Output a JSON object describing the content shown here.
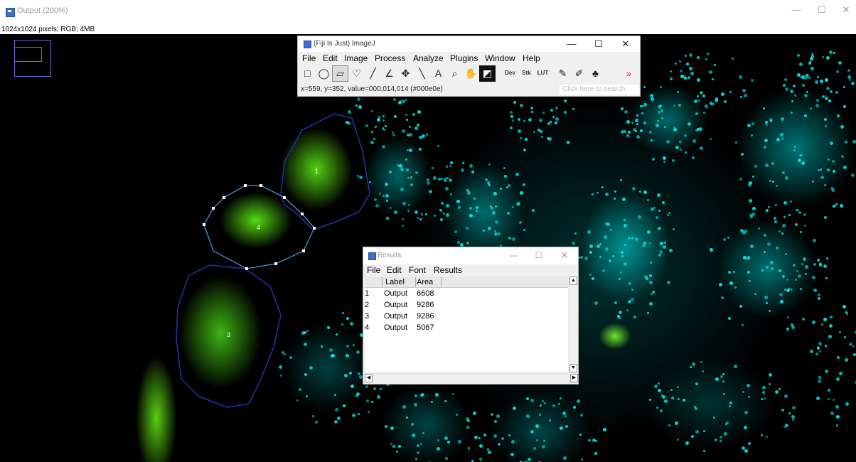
{
  "output_window": {
    "title": "Output (200%)",
    "info": "1024x1024 pixels; RGB; 4MB",
    "controls": {
      "minimize": "—",
      "maximize": "☐",
      "close": "✕"
    }
  },
  "roi_labels": [
    "1",
    "4",
    "3"
  ],
  "imagej": {
    "title": "(Fiji Is Just) ImageJ",
    "controls": {
      "minimize": "—",
      "maximize": "☐",
      "close": "✕"
    },
    "menu": [
      "File",
      "Edit",
      "Image",
      "Process",
      "Analyze",
      "Plugins",
      "Window",
      "Help"
    ],
    "tools": [
      {
        "name": "rectangle-tool",
        "glyph": "□",
        "selected": false
      },
      {
        "name": "oval-tool",
        "glyph": "◯",
        "selected": false
      },
      {
        "name": "polygon-tool",
        "glyph": "▱",
        "selected": true
      },
      {
        "name": "freehand-tool",
        "glyph": "♡",
        "selected": false
      },
      {
        "name": "line-tool",
        "glyph": "╱",
        "selected": false
      },
      {
        "name": "angle-tool",
        "glyph": "∠",
        "selected": false
      },
      {
        "name": "point-tool",
        "glyph": "✥",
        "selected": false
      },
      {
        "name": "wand-tool",
        "glyph": "╲",
        "selected": false
      },
      {
        "name": "text-tool",
        "glyph": "A",
        "selected": false
      },
      {
        "name": "magnifier-tool",
        "glyph": "⌕",
        "selected": false
      },
      {
        "name": "scroll-tool",
        "glyph": "✋",
        "selected": false
      },
      {
        "name": "color-picker-tool",
        "glyph": "◩",
        "selected": false
      },
      {
        "name": "developer-menu",
        "glyph": "Dev",
        "selected": false
      },
      {
        "name": "stack-tools",
        "glyph": "Stk",
        "selected": false
      },
      {
        "name": "lut-menu",
        "glyph": "LUT",
        "selected": false
      },
      {
        "name": "pencil-tool",
        "glyph": "✎",
        "selected": false
      },
      {
        "name": "brush-tool",
        "glyph": "✐",
        "selected": false
      },
      {
        "name": "flood-fill-tool",
        "glyph": "♣",
        "selected": false
      },
      {
        "name": "more-tools-button",
        "glyph": "»",
        "selected": false
      }
    ],
    "status": "x=559, y=352, value=000,014,014 (#000e0e)",
    "search_placeholder": "Click here to search"
  },
  "results": {
    "title": "Results",
    "controls": {
      "minimize": "—",
      "maximize": "☐",
      "close": "✕"
    },
    "menu": [
      "File",
      "Edit",
      "Font",
      "Results"
    ],
    "columns": [
      "Label",
      "Area"
    ],
    "rows": [
      {
        "index": "1",
        "label": "Output",
        "area": "6608"
      },
      {
        "index": "2",
        "label": "Output",
        "area": "9286"
      },
      {
        "index": "3",
        "label": "Output",
        "area": "9286"
      },
      {
        "index": "4",
        "label": "Output",
        "area": "5067"
      }
    ]
  },
  "colors": {
    "nuclei": "#00e5e5",
    "gfp": "#5fe01a",
    "roi_line": "#2233aa",
    "roi_handle": "#ffffff"
  }
}
